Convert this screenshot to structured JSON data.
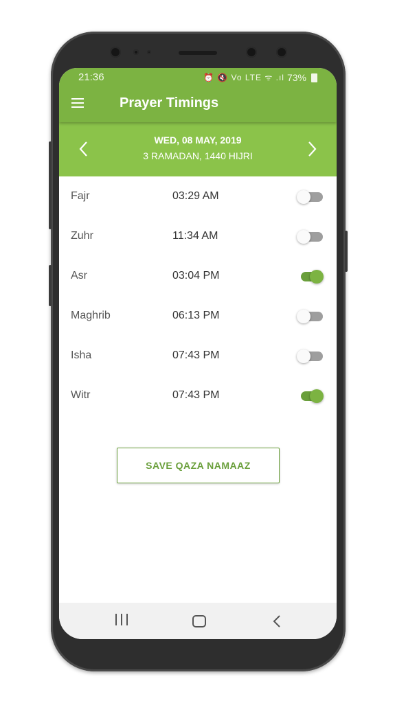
{
  "status_bar": {
    "time": "21:36",
    "icons": "⏰ 🔇 Vo LTE ᯤ .ıl",
    "battery": "73%"
  },
  "app_bar": {
    "title": "Prayer Timings",
    "menu_icon": "hamburger-menu-icon"
  },
  "date_header": {
    "gregorian": "WED, 08 MAY, 2019",
    "hijri": "3 RAMADAN, 1440 HIJRI",
    "prev_icon": "chevron-left-icon",
    "next_icon": "chevron-right-icon"
  },
  "prayers": [
    {
      "name": "Fajr",
      "time": "03:29 AM",
      "enabled": false
    },
    {
      "name": "Zuhr",
      "time": "11:34 AM",
      "enabled": false
    },
    {
      "name": "Asr",
      "time": "03:04 PM",
      "enabled": true
    },
    {
      "name": "Maghrib",
      "time": "06:13 PM",
      "enabled": false
    },
    {
      "name": "Isha",
      "time": "07:43 PM",
      "enabled": false
    },
    {
      "name": "Witr",
      "time": "07:43 PM",
      "enabled": true
    }
  ],
  "save_button": {
    "label": "SAVE QAZA NAMAAZ"
  },
  "colors": {
    "primary": "#7cb342",
    "primary_light": "#8bc34a",
    "accent_dark": "#6a9f3b"
  },
  "nav_bar": {
    "icons": [
      "recents-icon",
      "home-icon",
      "back-icon"
    ]
  }
}
